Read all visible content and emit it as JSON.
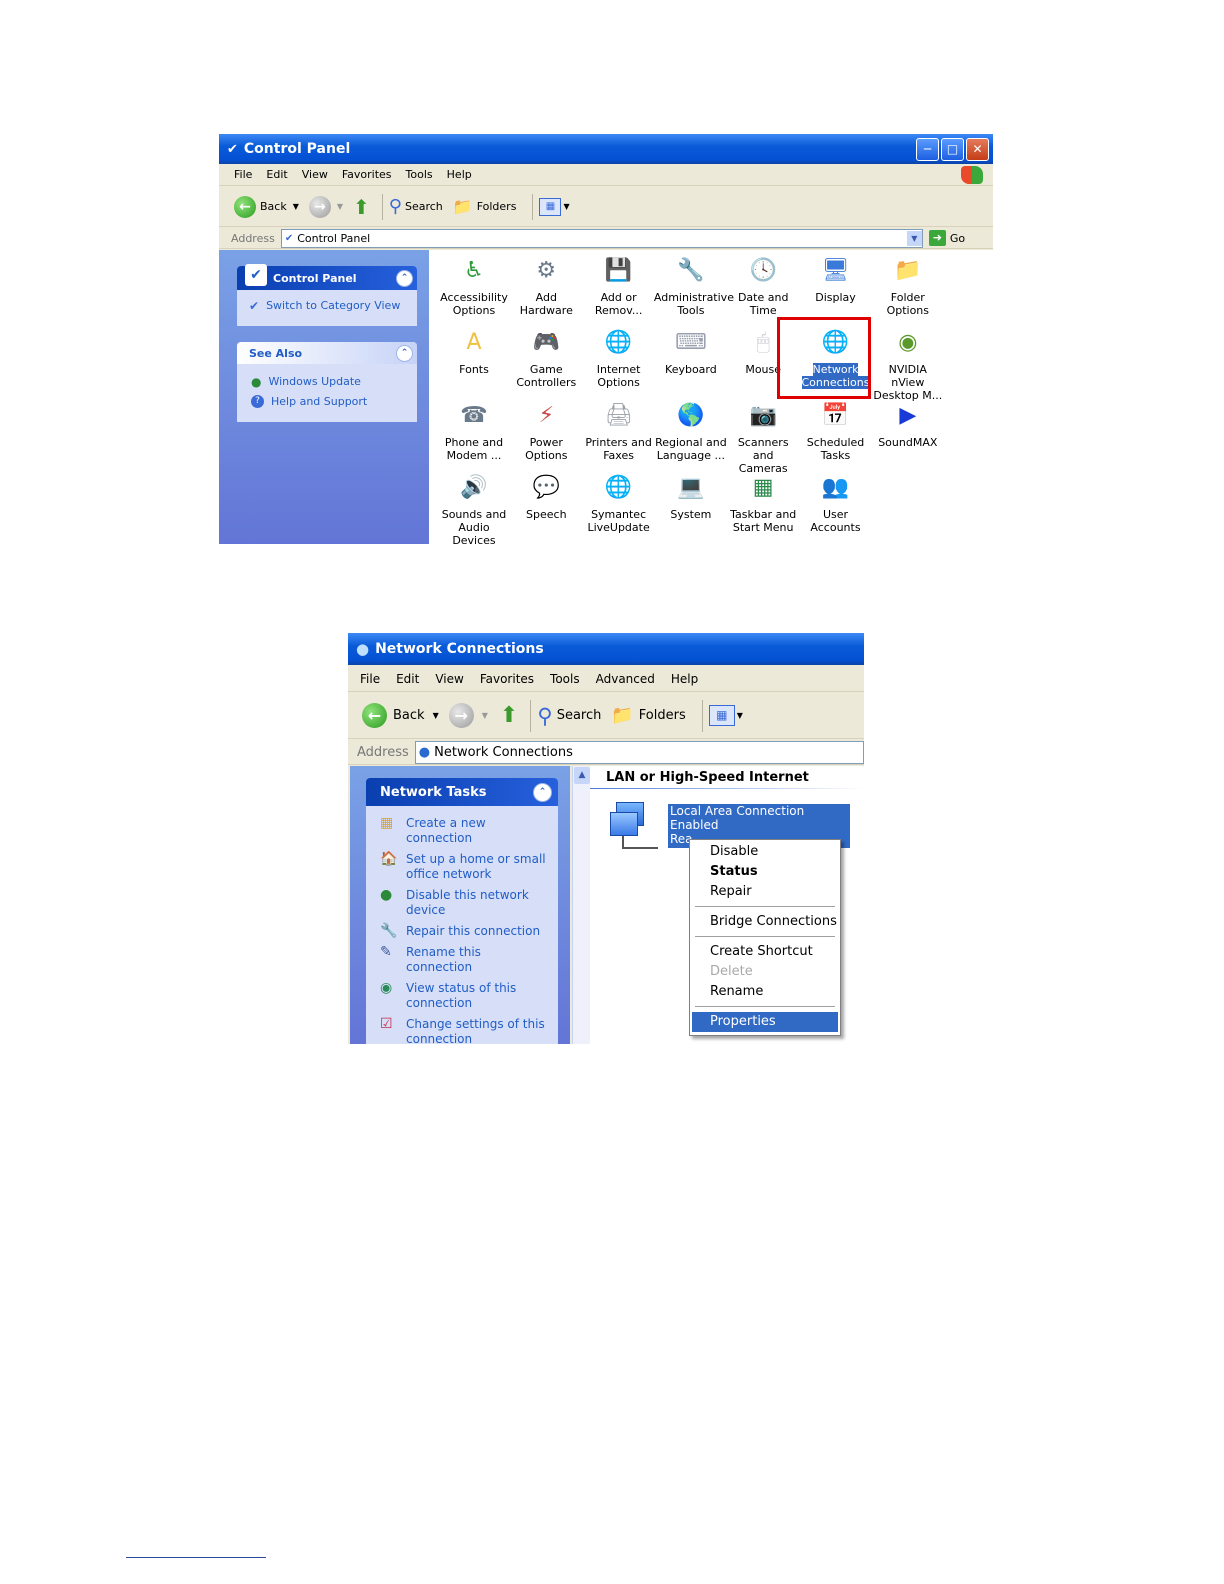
{
  "control_panel": {
    "title": "Control Panel",
    "menu": [
      "File",
      "Edit",
      "View",
      "Favorites",
      "Tools",
      "Help"
    ],
    "toolbar": {
      "back": "Back",
      "search": "Search",
      "folders": "Folders"
    },
    "address": {
      "label": "Address",
      "value": "Control Panel",
      "go": "Go"
    },
    "task_pane": {
      "header": "Control Panel",
      "switch_link": "Switch to Category View",
      "see_also_header": "See Also",
      "see_also_links": [
        "Windows Update",
        "Help and Support"
      ]
    },
    "items": [
      {
        "line1": "Accessibility",
        "line2": "Options",
        "icon": "accessibility-icon",
        "color": "#2f9a3a"
      },
      {
        "line1": "Add Hardware",
        "line2": "",
        "icon": "hardware-icon",
        "color": "#6b7a8a"
      },
      {
        "line1": "Add or",
        "line2": "Remov...",
        "icon": "add-remove-icon",
        "color": "#5a8ad8"
      },
      {
        "line1": "Administrative",
        "line2": "Tools",
        "icon": "admin-tools-icon",
        "color": "#d88a3a"
      },
      {
        "line1": "Date and Time",
        "line2": "",
        "icon": "clock-icon",
        "color": "#7a8ab0"
      },
      {
        "line1": "Display",
        "line2": "",
        "icon": "display-icon",
        "color": "#3a7ad8"
      },
      {
        "line1": "Folder Options",
        "line2": "",
        "icon": "folder-options-icon",
        "color": "#f0c040"
      },
      {
        "line1": "Fonts",
        "line2": "",
        "icon": "fonts-folder-icon",
        "color": "#f0c040"
      },
      {
        "line1": "Game",
        "line2": "Controllers",
        "icon": "gamepad-icon",
        "color": "#8a7ad8"
      },
      {
        "line1": "Internet",
        "line2": "Options",
        "icon": "internet-icon",
        "color": "#2a8ad8"
      },
      {
        "line1": "Keyboard",
        "line2": "",
        "icon": "keyboard-icon",
        "color": "#9aa0b0"
      },
      {
        "line1": "Mouse",
        "line2": "",
        "icon": "mouse-icon",
        "color": "#c8c8d0"
      },
      {
        "line1": "Network",
        "line2": "Connections",
        "icon": "network-globe-icon",
        "color": "#1a6ad0",
        "selected": true
      },
      {
        "line1": "NVIDIA nView",
        "line2": "Desktop M...",
        "icon": "nvidia-icon",
        "color": "#5a9a2a"
      },
      {
        "line1": "Phone and",
        "line2": "Modem ...",
        "icon": "phone-icon",
        "color": "#6a7a8a"
      },
      {
        "line1": "Power Options",
        "line2": "",
        "icon": "power-icon",
        "color": "#c84a4a"
      },
      {
        "line1": "Printers and",
        "line2": "Faxes",
        "icon": "printer-icon",
        "color": "#9aa0a8"
      },
      {
        "line1": "Regional and",
        "line2": "Language ...",
        "icon": "globe-icon",
        "color": "#2a9a6a"
      },
      {
        "line1": "Scanners and",
        "line2": "Cameras",
        "icon": "scanner-icon",
        "color": "#d8a040"
      },
      {
        "line1": "Scheduled",
        "line2": "Tasks",
        "icon": "scheduled-tasks-icon",
        "color": "#f0c040"
      },
      {
        "line1": "SoundMAX",
        "line2": "",
        "icon": "soundmax-icon",
        "color": "#1a3ad8"
      },
      {
        "line1": "Sounds and",
        "line2": "Audio Devices",
        "icon": "speaker-icon",
        "color": "#6a6a6a"
      },
      {
        "line1": "Speech",
        "line2": "",
        "icon": "speech-icon",
        "color": "#4a9a4a"
      },
      {
        "line1": "Symantec",
        "line2": "LiveUpdate",
        "icon": "liveupdate-icon",
        "color": "#e8c020"
      },
      {
        "line1": "System",
        "line2": "",
        "icon": "system-icon",
        "color": "#3a7ad8"
      },
      {
        "line1": "Taskbar and",
        "line2": "Start Menu",
        "icon": "taskbar-icon",
        "color": "#2a8a4a"
      },
      {
        "line1": "User Accounts",
        "line2": "",
        "icon": "users-icon",
        "color": "#d86a2a"
      }
    ]
  },
  "network_connections": {
    "title": "Network Connections",
    "menu": [
      "File",
      "Edit",
      "View",
      "Favorites",
      "Tools",
      "Advanced",
      "Help"
    ],
    "toolbar": {
      "back": "Back",
      "search": "Search",
      "folders": "Folders"
    },
    "address": {
      "label": "Address",
      "value": "Network Connections"
    },
    "task_pane": {
      "header": "Network Tasks",
      "links": [
        {
          "text": "Create a new connection",
          "icon": "new-connection-icon"
        },
        {
          "text": "Set up a home or small office network",
          "icon": "home-network-icon"
        },
        {
          "text": "Disable this network device",
          "icon": "disable-network-icon"
        },
        {
          "text": "Repair this connection",
          "icon": "repair-icon"
        },
        {
          "text": "Rename this connection",
          "icon": "rename-icon"
        },
        {
          "text": "View status of this connection",
          "icon": "status-icon"
        },
        {
          "text": "Change settings of this connection",
          "icon": "settings-icon"
        }
      ]
    },
    "group_header": "LAN or High-Speed Internet",
    "connection": {
      "name": "Local Area Connection",
      "status": "Enabled",
      "device_prefix": "Rea"
    },
    "context_menu": {
      "groups": [
        [
          {
            "label": "Disable"
          },
          {
            "label": "Status",
            "bold": true
          },
          {
            "label": "Repair"
          }
        ],
        [
          {
            "label": "Bridge Connections"
          }
        ],
        [
          {
            "label": "Create Shortcut"
          },
          {
            "label": "Delete",
            "disabled": true
          },
          {
            "label": "Rename"
          }
        ],
        [
          {
            "label": "Properties",
            "highlighted": true
          }
        ]
      ]
    }
  }
}
